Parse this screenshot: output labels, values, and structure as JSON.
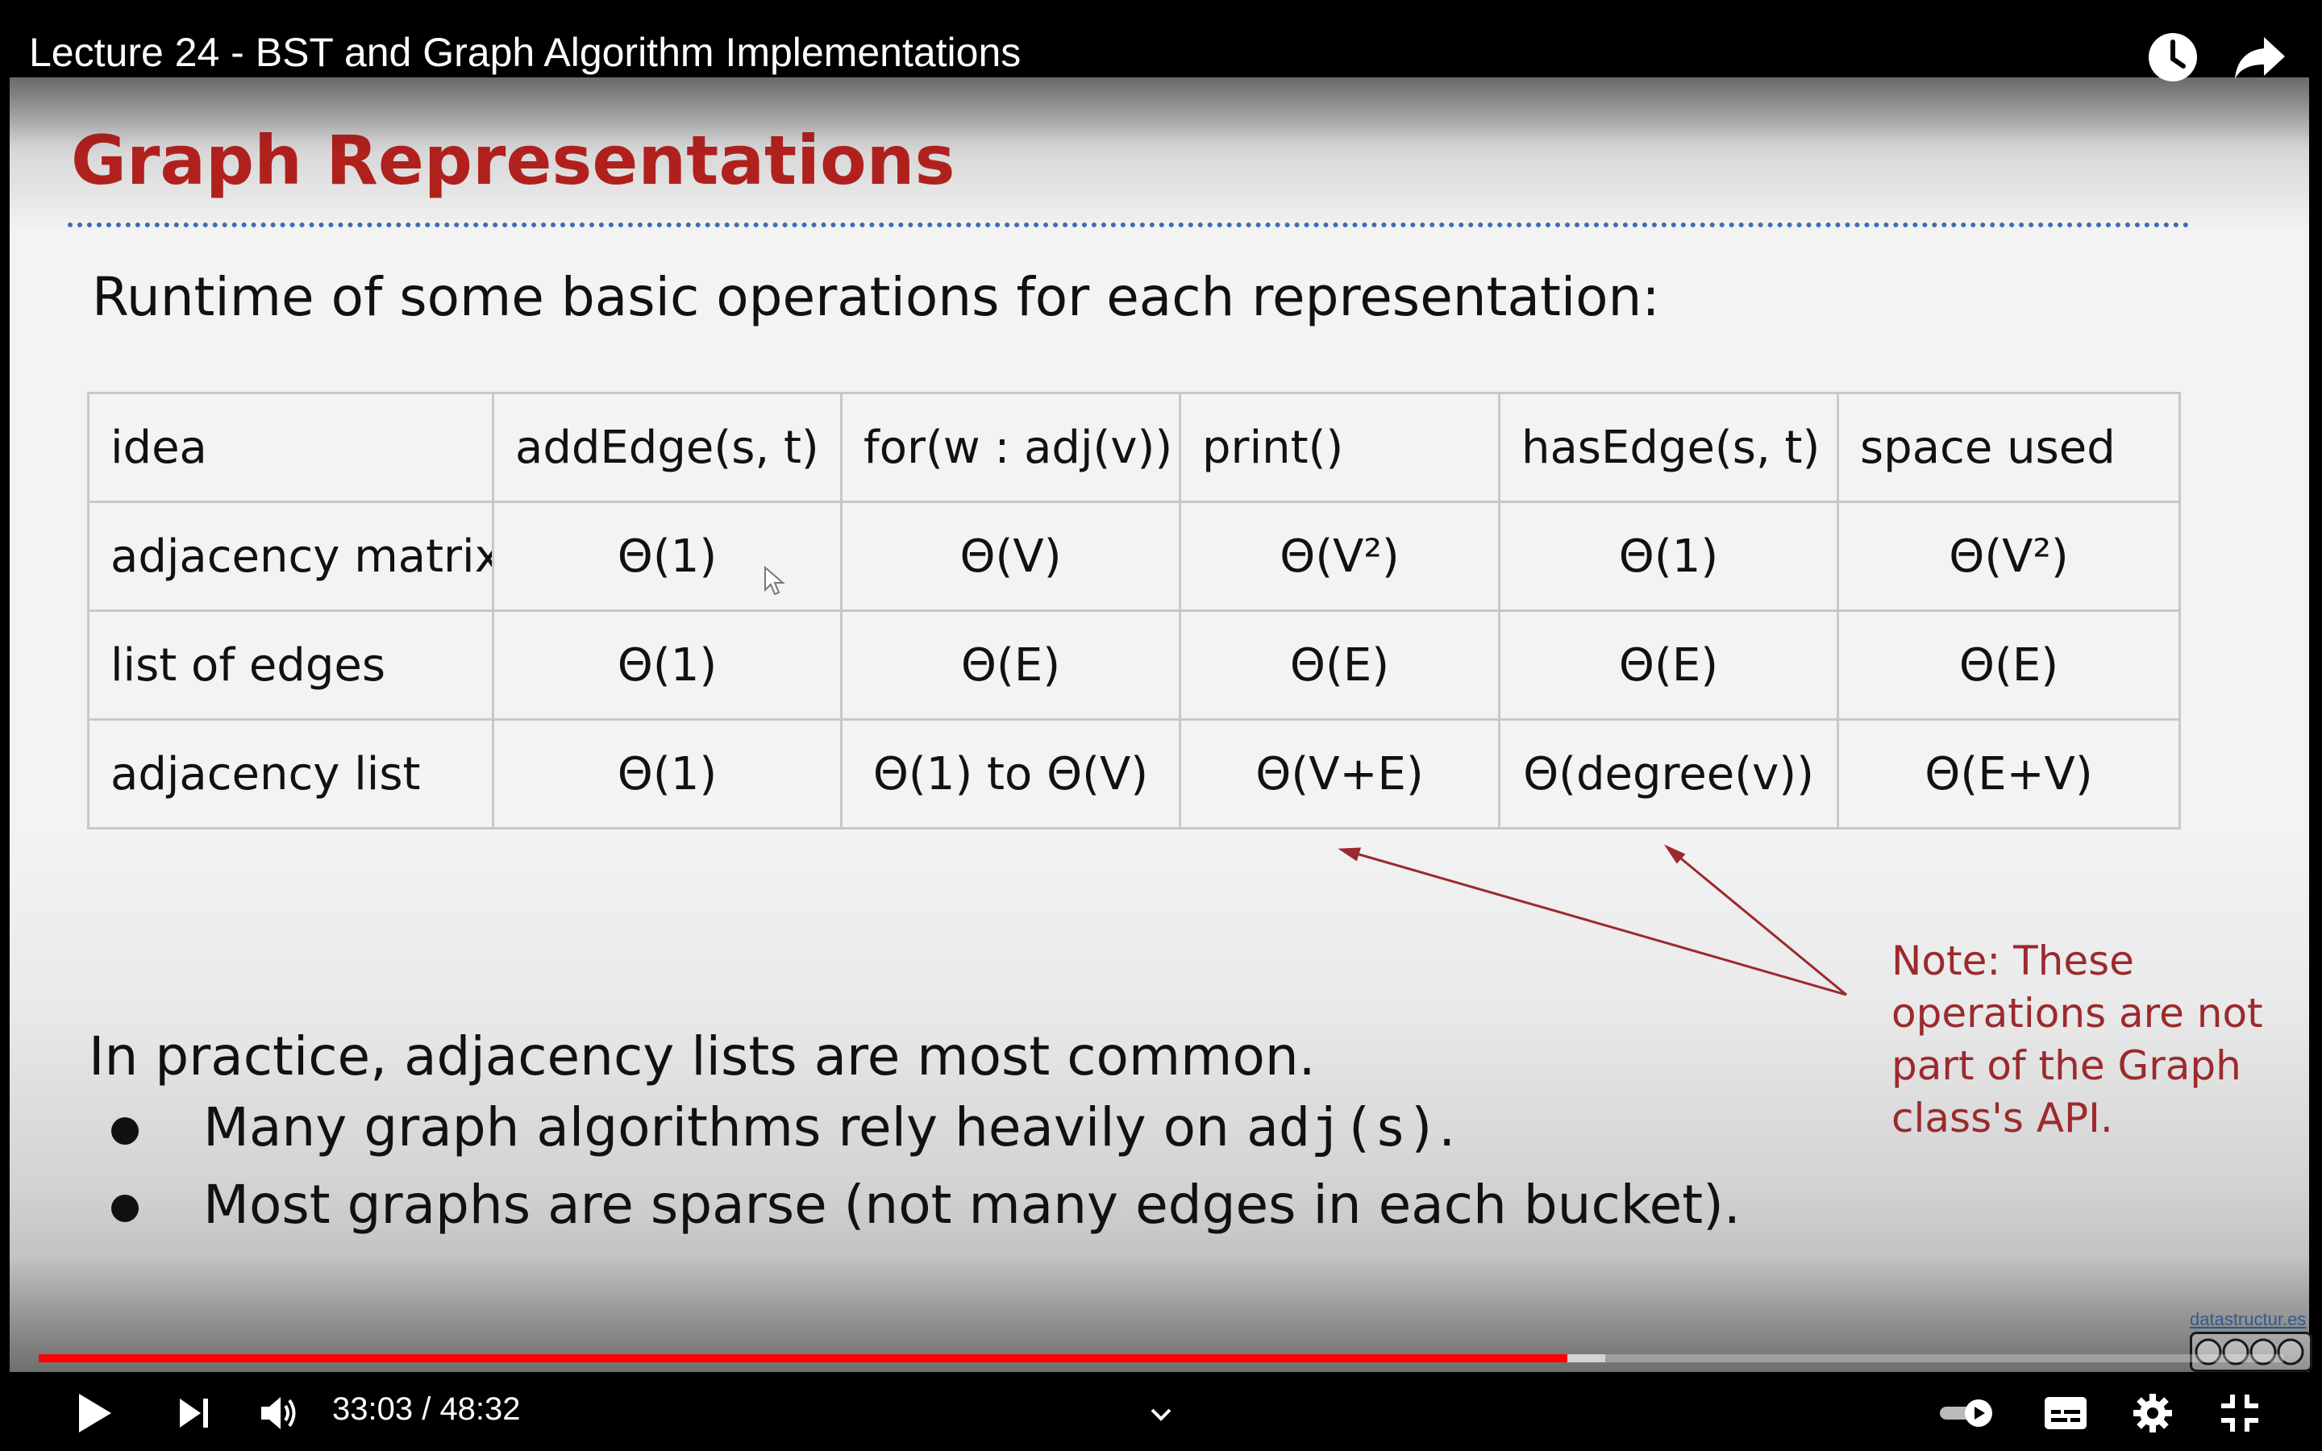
{
  "player": {
    "title": "Lecture 24 - BST and Graph Algorithm Implementations",
    "current_time": "33:03",
    "duration": "48:32",
    "time_display": "33:03 / 48:32",
    "progress_fraction": 0.681,
    "buffered_fraction": 0.698,
    "accent_color": "#ff0000",
    "icons": {
      "watch_later": "clock-icon",
      "share": "share-arrow-icon",
      "play": "play-icon",
      "next": "skip-next-icon",
      "volume": "volume-icon",
      "chapters": "chevron-down-icon",
      "autoplay": "autoplay-toggle-icon",
      "subtitles": "subtitles-icon",
      "settings": "gear-icon",
      "fullscreen_exit": "exit-fullscreen-icon"
    }
  },
  "slide": {
    "title": "Graph Representations",
    "title_color": "#b0211e",
    "subtitle": "Runtime of some basic operations for each representation:",
    "table": {
      "headers": [
        "idea",
        "addEdge(s, t)",
        "for(w : adj(v))",
        "print()",
        "hasEdge(s, t)",
        "space used"
      ],
      "rows": [
        [
          "adjacency matrix",
          "Θ(1)",
          "Θ(V)",
          "Θ(V²)",
          "Θ(1)",
          "Θ(V²)"
        ],
        [
          "list of edges",
          "Θ(1)",
          "Θ(E)",
          "Θ(E)",
          "Θ(E)",
          "Θ(E)"
        ],
        [
          "adjacency list",
          "Θ(1)",
          "Θ(1) to Θ(V)",
          "Θ(V+E)",
          "Θ(degree(v))",
          "Θ(E+V)"
        ]
      ]
    },
    "note": "Note: These operations are not part of the Graph class's API.",
    "note_color": "#9b2a2e",
    "practice_line": "In practice, adjacency lists are most common.",
    "bullets": [
      {
        "prefix": "Many graph algorithms rely heavily on ",
        "code": "adj(s)",
        "suffix": "."
      },
      {
        "prefix": "Most graphs are sparse (not many edges in each bucket).",
        "code": "",
        "suffix": ""
      }
    ],
    "watermark": "datastructur.es"
  }
}
